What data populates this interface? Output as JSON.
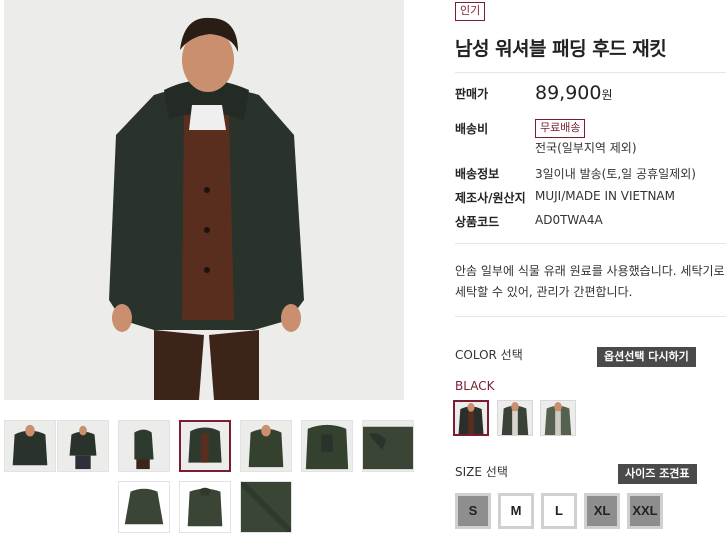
{
  "product": {
    "badge": "인기",
    "title": "남성 워셔블 패딩 후드 재킷",
    "price_label": "판매가",
    "price": "89,900",
    "price_unit": "원",
    "shipping_label": "배송비",
    "shipping_badge": "무료배송",
    "shipping_note": "전국(일부지역 제외)",
    "delivery_label": "배송정보",
    "delivery_value": "3일이내 발송(토,일 공휴일제외)",
    "maker_label": "제조사/원산지",
    "maker_value": "MUJI/MADE IN VIETNAM",
    "code_label": "상품코드",
    "code_value": "AD0TWA4A",
    "description": "안솜 일부에 식물 유래 원료를 사용했습니다. 세탁기로 세탁할 수 있어, 관리가 간편합니다."
  },
  "options": {
    "color_label": "COLOR 선택",
    "reset_button": "옵션선택 다시하기",
    "selected_color": "BLACK",
    "colors": [
      {
        "name": "black",
        "hex": "#2b2f2b"
      },
      {
        "name": "dark green",
        "hex": "#3a4237"
      },
      {
        "name": "khaki",
        "hex": "#56604f"
      }
    ],
    "size_label": "SIZE 선택",
    "size_chart_button": "사이즈 조견표",
    "sizes": [
      {
        "label": "S",
        "available": false
      },
      {
        "label": "M",
        "available": true
      },
      {
        "label": "L",
        "available": true
      },
      {
        "label": "XL",
        "available": false
      },
      {
        "label": "XXL",
        "available": false
      }
    ]
  },
  "gallery": {
    "thumbnail_count": 10,
    "selected_index": 3,
    "colors": {
      "jacket": "#2f3a2f",
      "sweater": "#5a2e1f",
      "skin": "#c98f6e",
      "background": "#ececea"
    }
  }
}
